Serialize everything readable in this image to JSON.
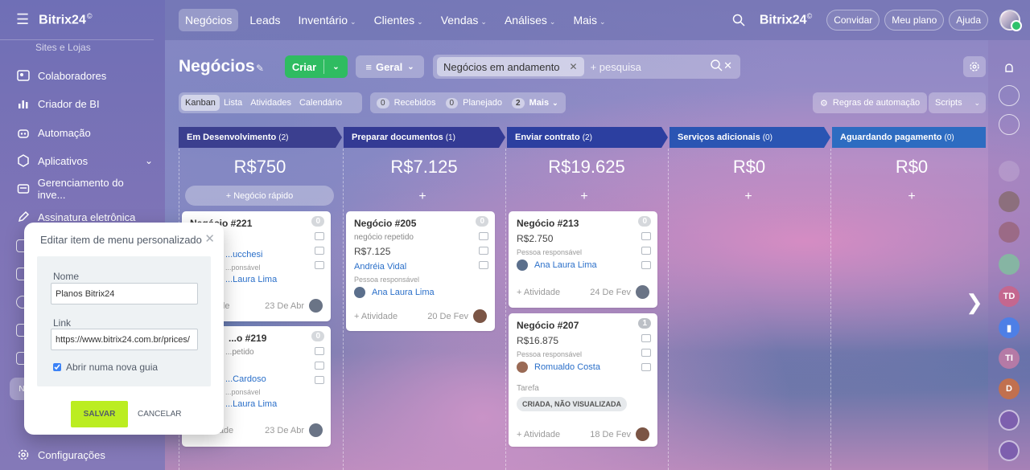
{
  "sidebar": {
    "brand": "Bitrix24",
    "brand_mark": "©",
    "cut_item": "Sites e Lojas",
    "items": [
      {
        "label": "Colaboradores",
        "icon": "people-icon"
      },
      {
        "label": "Criador de BI",
        "icon": "bar-chart-icon"
      },
      {
        "label": "Automação",
        "icon": "robot-icon"
      },
      {
        "label": "Aplicativos",
        "icon": "cube-icon"
      },
      {
        "label": "Gerenciamento do inve...",
        "icon": "inventory-icon"
      },
      {
        "label": "Assinatura eletrônica",
        "icon": "pen-icon"
      },
      {
        "label": "Configurações",
        "icon": "gear-icon"
      }
    ]
  },
  "topnav": {
    "items": [
      "Negócios",
      "Leads",
      "Inventário",
      "Clientes",
      "Vendas",
      "Análises",
      "Mais"
    ],
    "brand": "Bitrix24",
    "brand_mark": "©",
    "invite": "Convidar",
    "my_plan": "Meu plano",
    "help": "Ajuda"
  },
  "header": {
    "title": "Negócios",
    "create": "Criar",
    "pipeline": "Geral",
    "filter_chip": "Negócios em andamento",
    "search_placeholder": "+ pesquisa"
  },
  "views": [
    "Kanban",
    "Lista",
    "Atividades",
    "Calendário"
  ],
  "counters": [
    {
      "n": "0",
      "label": "Recebidos"
    },
    {
      "n": "0",
      "label": "Planejado"
    },
    {
      "n": "2",
      "label": "Mais"
    }
  ],
  "automation_rules": "Regras de automação",
  "scripts": "Scripts",
  "quick_add": "+ Negócio rápido",
  "columns": [
    {
      "name": "Em Desenvolvimento",
      "count": "(2)",
      "sum": "R$750",
      "color": "#3b3f8f"
    },
    {
      "name": "Preparar documentos",
      "count": "(1)",
      "sum": "R$7.125",
      "color": "#333a94"
    },
    {
      "name": "Enviar contrato",
      "count": "(2)",
      "sum": "R$19.625",
      "color": "#2c3fa0"
    },
    {
      "name": "Serviços adicionais",
      "count": "(0)",
      "sum": "R$0",
      "color": "#2a55b3"
    },
    {
      "name": "Aguardando pagamento",
      "count": "(0)",
      "sum": "R$0",
      "color": "#2d6cc1"
    }
  ],
  "cards": {
    "c221": {
      "title": "Negócio #221",
      "badge": "0",
      "link": "...ucchesi",
      "resp": "...ponsável",
      "person": "...Laura Lima",
      "activity": "...ade",
      "date": "23 De Abr"
    },
    "c219": {
      "title": "...o #219",
      "badge": "0",
      "sub": "...petido",
      "link": "...Cardoso",
      "resp": "...ponsável",
      "person": "...Laura Lima",
      "activity": "+ Atividade",
      "date": "23 De Abr"
    },
    "c205": {
      "title": "Negócio #205",
      "badge": "0",
      "sub": "negócio repetido",
      "amount": "R$7.125",
      "link": "Andréia Vidal",
      "resp": "Pessoa responsável",
      "person": "Ana Laura Lima",
      "activity": "+ Atividade",
      "date": "20 De Fev"
    },
    "c213": {
      "title": "Negócio #213",
      "badge": "0",
      "amount": "R$2.750",
      "resp": "Pessoa responsável",
      "person": "Ana Laura Lima",
      "activity": "+ Atividade",
      "date": "24 De Fev"
    },
    "c207": {
      "title": "Negócio #207",
      "badge": "1",
      "amount": "R$16.875",
      "resp": "Pessoa responsável",
      "person": "Romualdo Costa",
      "task_label": "Tarefa",
      "task_tag": "CRIADA, NÃO VISUALIZADA",
      "activity": "+ Atividade",
      "date": "18 De Fev"
    }
  },
  "right_rail": [
    "TD",
    "TI",
    "D"
  ],
  "modal": {
    "title": "Editar item de menu personalizado",
    "name_label": "Nome",
    "name_value": "Planos Bitrix24",
    "link_label": "Link",
    "link_value": "https://www.bitrix24.com.br/prices/",
    "checkbox_label": "Abrir numa nova guia",
    "save": "SALVAR",
    "cancel": "CANCELAR"
  }
}
